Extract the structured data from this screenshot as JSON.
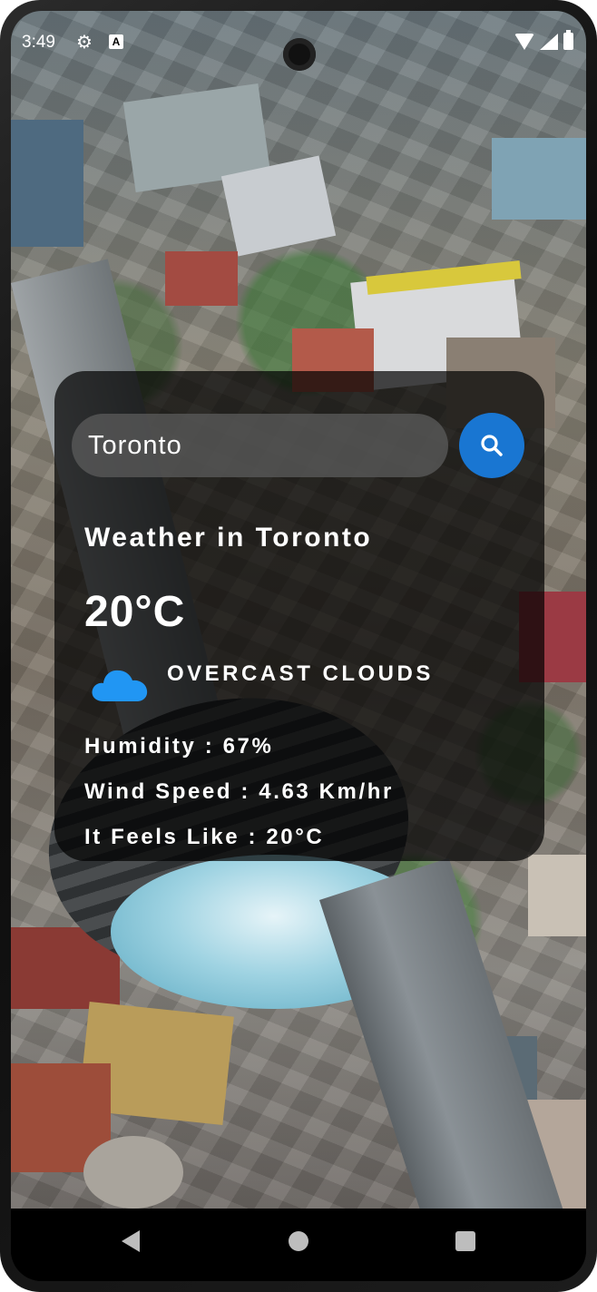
{
  "status_bar": {
    "time": "3:49",
    "icons": [
      "gear-icon",
      "a-notification-icon",
      "wifi-icon",
      "signal-icon",
      "battery-icon"
    ]
  },
  "search": {
    "value": "Toronto",
    "button_icon": "search-icon"
  },
  "weather": {
    "heading": "Weather in Toronto",
    "temperature": "20°C",
    "condition_icon": "cloud-icon",
    "description": "OVERCAST CLOUDS",
    "humidity": "Humidity : 67%",
    "wind_speed": "Wind Speed : 4.63 Km/hr",
    "feels_like": "It Feels Like : 20°C"
  },
  "nav_bar": {
    "icons": [
      "back-icon",
      "home-icon",
      "recents-icon"
    ]
  },
  "colors": {
    "accent": "#1976d2",
    "cloud": "#2196f3",
    "card_background": "rgba(0,0,0,0.7)"
  }
}
